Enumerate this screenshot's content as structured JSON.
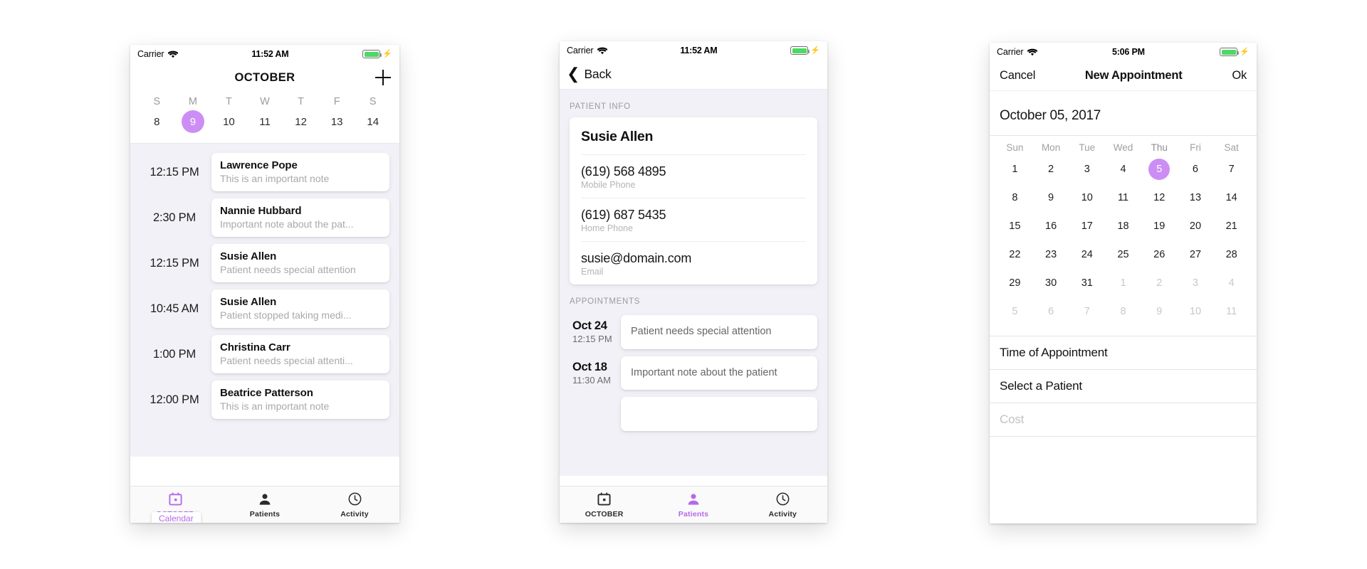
{
  "accent": "#cc8ef5",
  "accent_text": "#b469ea",
  "phone1": {
    "statusbar": {
      "carrier": "Carrier",
      "wifi_icon": "wifi-icon",
      "time": "11:52 AM",
      "battery_icon": "battery-icon",
      "charging_icon": "lightning-bolt-icon"
    },
    "navbar": {
      "title": "OCTOBER",
      "add_icon": "plus-icon"
    },
    "week": {
      "dow": [
        "S",
        "M",
        "T",
        "W",
        "T",
        "F",
        "S"
      ],
      "days": [
        "8",
        "9",
        "10",
        "11",
        "12",
        "13",
        "14"
      ],
      "selected_index": 1
    },
    "appointments": [
      {
        "time": "12:15 PM",
        "name": "Lawrence Pope",
        "note": "This is an important note"
      },
      {
        "time": "2:30 PM",
        "name": "Nannie Hubbard",
        "note": "Important note about the pat..."
      },
      {
        "time": "12:15 PM",
        "name": "Susie Allen",
        "note": "Patient needs special attention"
      },
      {
        "time": "10:45 AM",
        "name": "Susie Allen",
        "note": "Patient stopped taking medi..."
      },
      {
        "time": "1:00 PM",
        "name": "Christina Carr",
        "note": "Patient needs special attenti..."
      },
      {
        "time": "12:00 PM",
        "name": "Beatrice Patterson",
        "note": "This is an important note"
      }
    ],
    "tabbar": {
      "tooltip": "Calendar",
      "items": [
        {
          "label": "OCTOBER",
          "icon": "calendar-icon",
          "active": true
        },
        {
          "label": "Patients",
          "icon": "person-icon",
          "active": false
        },
        {
          "label": "Activity",
          "icon": "clock-icon",
          "active": false
        }
      ]
    }
  },
  "phone2": {
    "statusbar": {
      "carrier": "Carrier",
      "wifi_icon": "wifi-icon",
      "time": "11:52 AM",
      "battery_icon": "battery-icon",
      "charging_icon": "lightning-bolt-icon"
    },
    "navbar": {
      "back_label": "Back",
      "back_icon": "chevron-left-icon"
    },
    "patient_info": {
      "section_header": "PATIENT INFO",
      "name": "Susie Allen",
      "fields": [
        {
          "value": "(619) 568 4895",
          "label": "Mobile Phone"
        },
        {
          "value": "(619) 687 5435",
          "label": "Home Phone"
        },
        {
          "value": "susie@domain.com",
          "label": "Email"
        }
      ]
    },
    "appointments": {
      "section_header": "APPOINTMENTS",
      "items": [
        {
          "date": "Oct 24",
          "time": "12:15 PM",
          "note": "Patient needs special attention"
        },
        {
          "date": "Oct 18",
          "time": "11:30 AM",
          "note": "Important note about the patient"
        }
      ]
    },
    "tabbar": {
      "items": [
        {
          "label": "OCTOBER",
          "icon": "calendar-icon",
          "active": false
        },
        {
          "label": "Patients",
          "icon": "person-icon",
          "active": true
        },
        {
          "label": "Activity",
          "icon": "clock-icon",
          "active": false
        }
      ]
    }
  },
  "phone3": {
    "statusbar": {
      "carrier": "Carrier",
      "wifi_icon": "wifi-icon",
      "time": "5:06 PM",
      "battery_icon": "battery-icon",
      "charging_icon": "lightning-bolt-icon"
    },
    "navbar": {
      "cancel": "Cancel",
      "title": "New Appointment",
      "ok": "Ok"
    },
    "selected_date": "October 05, 2017",
    "calendar": {
      "dow": [
        "Sun",
        "Mon",
        "Tue",
        "Wed",
        "Thu",
        "Fri",
        "Sat"
      ],
      "highlight_dow_index": 4,
      "weeks": [
        [
          {
            "d": "1"
          },
          {
            "d": "2"
          },
          {
            "d": "3"
          },
          {
            "d": "4"
          },
          {
            "d": "5",
            "sel": true
          },
          {
            "d": "6"
          },
          {
            "d": "7"
          }
        ],
        [
          {
            "d": "8"
          },
          {
            "d": "9"
          },
          {
            "d": "10"
          },
          {
            "d": "11"
          },
          {
            "d": "12"
          },
          {
            "d": "13"
          },
          {
            "d": "14"
          }
        ],
        [
          {
            "d": "15"
          },
          {
            "d": "16"
          },
          {
            "d": "17"
          },
          {
            "d": "18"
          },
          {
            "d": "19"
          },
          {
            "d": "20"
          },
          {
            "d": "21"
          }
        ],
        [
          {
            "d": "22"
          },
          {
            "d": "23"
          },
          {
            "d": "24"
          },
          {
            "d": "25"
          },
          {
            "d": "26"
          },
          {
            "d": "27"
          },
          {
            "d": "28"
          }
        ],
        [
          {
            "d": "29"
          },
          {
            "d": "30"
          },
          {
            "d": "31"
          },
          {
            "d": "1",
            "dim": true
          },
          {
            "d": "2",
            "dim": true
          },
          {
            "d": "3",
            "dim": true
          },
          {
            "d": "4",
            "dim": true
          }
        ],
        [
          {
            "d": "5",
            "dim": true
          },
          {
            "d": "6",
            "dim": true
          },
          {
            "d": "7",
            "dim": true
          },
          {
            "d": "8",
            "dim": true
          },
          {
            "d": "9",
            "dim": true
          },
          {
            "d": "10",
            "dim": true
          },
          {
            "d": "11",
            "dim": true
          }
        ]
      ]
    },
    "form": [
      {
        "label": "Time of Appointment",
        "placeholder": false
      },
      {
        "label": "Select a Patient",
        "placeholder": false
      },
      {
        "label": "Cost",
        "placeholder": true
      }
    ]
  }
}
